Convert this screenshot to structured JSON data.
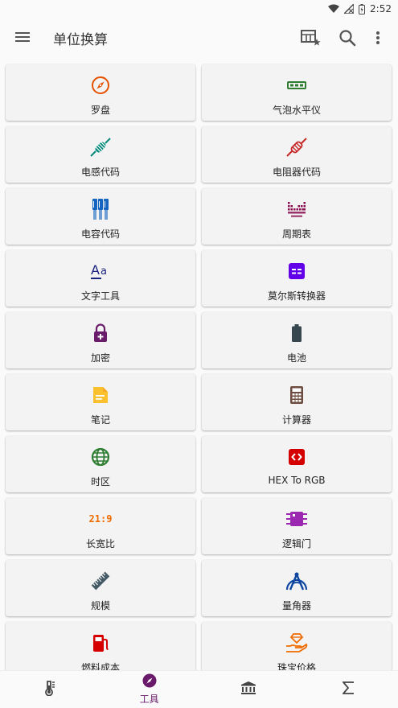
{
  "status": {
    "time": "2:52"
  },
  "app_bar": {
    "title": "单位换算"
  },
  "tools": [
    {
      "label": "罗盘",
      "icon": "compass-icon",
      "color": "#e65100"
    },
    {
      "label": "气泡水平仪",
      "icon": "bubble-level-icon",
      "color": "#2e7d32"
    },
    {
      "label": "电感代码",
      "icon": "inductor-icon",
      "color": "#00897b"
    },
    {
      "label": "电阻器代码",
      "icon": "resistor-icon",
      "color": "#c62828"
    },
    {
      "label": "电容代码",
      "icon": "capacitor-icon",
      "color": "#1565c0"
    },
    {
      "label": "周期表",
      "icon": "periodic-table-icon",
      "color": "#880e4f"
    },
    {
      "label": "文字工具",
      "icon": "text-tool-icon",
      "color": "#1a237e"
    },
    {
      "label": "莫尔斯转换器",
      "icon": "morse-converter-icon",
      "color": "#6200ea"
    },
    {
      "label": "加密",
      "icon": "lock-icon",
      "color": "#6a1b6a"
    },
    {
      "label": "电池",
      "icon": "battery-icon",
      "color": "#37474f"
    },
    {
      "label": "笔记",
      "icon": "note-icon",
      "color": "#fbc02d"
    },
    {
      "label": "计算器",
      "icon": "calculator-icon",
      "color": "#6d4c41"
    },
    {
      "label": "时区",
      "icon": "globe-icon",
      "color": "#2e7d32"
    },
    {
      "label": "HEX To RGB",
      "icon": "code-icon",
      "color": "#d50000"
    },
    {
      "label": "长宽比",
      "icon": "aspect-ratio-icon",
      "color": "#ef6c00",
      "icon_text": "21:9"
    },
    {
      "label": "逻辑门",
      "icon": "chip-icon",
      "color": "#9c27b0"
    },
    {
      "label": "规模",
      "icon": "ruler-icon",
      "color": "#455a64"
    },
    {
      "label": "量角器",
      "icon": "protractor-icon",
      "color": "#0d47a1"
    },
    {
      "label": "燃料成本",
      "icon": "fuel-icon",
      "color": "#d50000"
    },
    {
      "label": "珠宝价格",
      "icon": "jewelry-icon",
      "color": "#ef6c00"
    }
  ],
  "bottom_nav": [
    {
      "icon": "thermometer-icon",
      "label": ""
    },
    {
      "icon": "compass-icon",
      "label": "工具",
      "active": true
    },
    {
      "icon": "bank-icon",
      "label": ""
    },
    {
      "icon": "sigma-icon",
      "label": ""
    }
  ]
}
